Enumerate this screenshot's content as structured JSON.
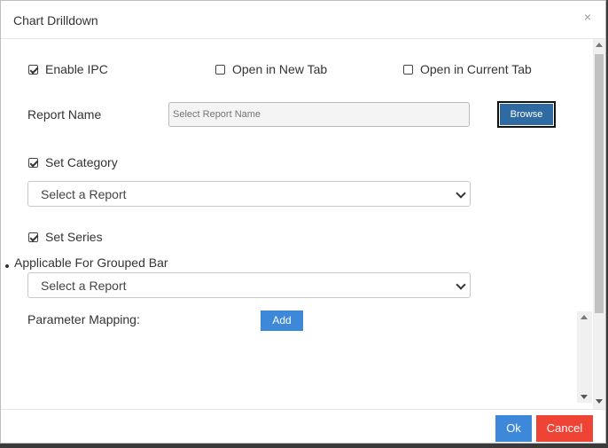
{
  "dialog": {
    "title": "Chart Drilldown",
    "close_glyph": "×"
  },
  "options": {
    "enable_ipc": {
      "label": "Enable IPC",
      "checked": true
    },
    "open_new_tab": {
      "label": "Open in New Tab",
      "checked": false
    },
    "open_current_tab": {
      "label": "Open in Current Tab",
      "checked": false
    }
  },
  "report_name": {
    "label": "Report Name",
    "placeholder": "Select Report Name",
    "browse_label": "Browse"
  },
  "category": {
    "checkbox_label": "Set Category",
    "select_value": "Select a Report"
  },
  "series": {
    "checkbox_label": "Set Series",
    "note": "Applicable For Grouped Bar",
    "select_value": "Select a Report"
  },
  "parameter_mapping": {
    "label": "Parameter Mapping:",
    "add_label": "Add"
  },
  "footer": {
    "ok_label": "Ok",
    "cancel_label": "Cancel"
  },
  "colors": {
    "primary": "#3d88d8",
    "danger": "#ef4335",
    "browse": "#2f6aa3"
  }
}
